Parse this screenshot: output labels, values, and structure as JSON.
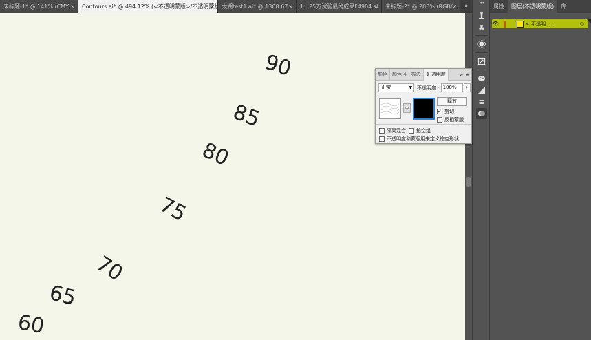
{
  "tabs": [
    {
      "label": "未标题-1* @ 141% (CMY…",
      "active": false
    },
    {
      "label": "Contours.ai* @ 494.12% (<不透明蒙版>/不透明蒙版)",
      "active": true
    },
    {
      "label": "太湖test1.ai* @ 1308.67…",
      "active": false
    },
    {
      "label": "1：25万试验最终成果F4904.ai",
      "active": false
    },
    {
      "label": "未标题-2* @ 200% (RGB/…",
      "active": false
    }
  ],
  "tab_close_glyph": "×",
  "tab_overflow_glyph": "»",
  "contour_labels": [
    "90",
    "85",
    "80",
    "75",
    "70",
    "65",
    "60"
  ],
  "right_panel": {
    "tabs": [
      "属性",
      "图层(不透明蒙版)",
      "库"
    ],
    "active_tab": 1,
    "layer_name": "< 不透明 . . ."
  },
  "transparency_panel": {
    "tabs": [
      "颜色",
      "颜色 4",
      "描边",
      "⇕ 透明度"
    ],
    "active_tab": 3,
    "expand_glyph": "»",
    "menu_glyph": "≡",
    "blend_mode": "正常",
    "opacity_label": "不透明度 :",
    "opacity_value": "100%",
    "release_button": "释放",
    "clip_label": "剪切",
    "clip_checked": true,
    "invert_label": "反相蒙版",
    "invert_checked": false,
    "isolate_label": "隔离混合",
    "knockout_label": "挖空组",
    "define_knockout_label": "不透明度和蒙版用来定义挖空形状"
  },
  "colors": {
    "canvas": "#f3f6e8",
    "layer_highlight": "#b4c10a",
    "layer_swatch": "#ffe600",
    "mask_border": "#2d7fd6"
  },
  "icons": [
    "puppet-warp-icon",
    "club-symbol-icon",
    "sun-brush-icon",
    "artboard-export-icon",
    "palette-icon",
    "gradient-icon",
    "stroke-lines-icon",
    "transparency-icon"
  ]
}
